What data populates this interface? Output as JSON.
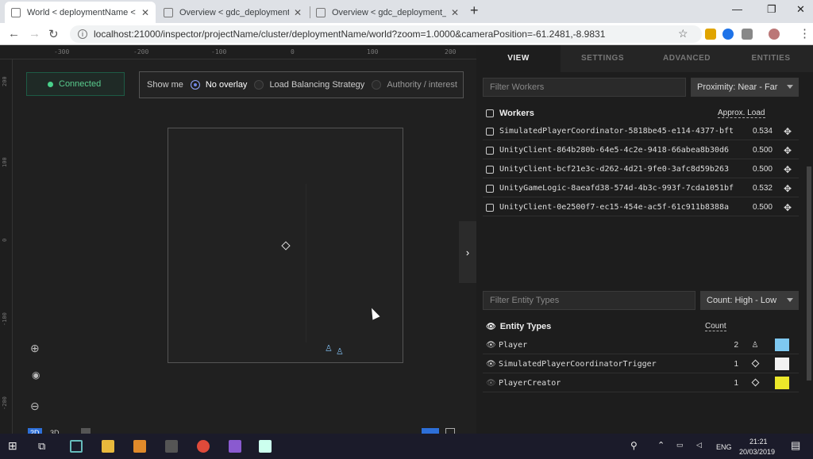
{
  "browser": {
    "tabs": [
      {
        "title": "World < deploymentName < pr"
      },
      {
        "title": "Overview < gdc_deployment < g"
      },
      {
        "title": "Overview < gdc_deployment_sir"
      }
    ],
    "url": "localhost:21000/inspector/projectName/cluster/deploymentName/world?zoom=1.0000&cameraPosition=-61.2481,-8.9831"
  },
  "ruler": {
    "top": [
      "-300",
      "-200",
      "-100",
      "0",
      "100",
      "200"
    ],
    "left": [
      "200",
      "100",
      "0",
      "-100",
      "-200"
    ]
  },
  "status": {
    "connected": "Connected"
  },
  "overlay": {
    "label": "Show me",
    "options": [
      "No overlay",
      "Load Balancing Strategy",
      "Authority / interest"
    ],
    "selected": "No overlay"
  },
  "viewmode": {
    "a": "2D",
    "b": "3D"
  },
  "panel": {
    "tabs": [
      "VIEW",
      "SETTINGS",
      "ADVANCED",
      "ENTITIES"
    ],
    "workers": {
      "filter_placeholder": "Filter Workers",
      "sort": "Proximity: Near - Far",
      "header": "Workers",
      "load_header": "Approx. Load",
      "rows": [
        {
          "name": "SimulatedPlayerCoordinator-5818be45-e114-4377-bft",
          "load": "0.534"
        },
        {
          "name": "UnityClient-864b280b-64e5-4c2e-9418-66abea8b30d6",
          "load": "0.500"
        },
        {
          "name": "UnityClient-bcf21e3c-d262-4d21-9fe0-3afc8d59b263",
          "load": "0.500"
        },
        {
          "name": "UnityGameLogic-8aeafd38-574d-4b3c-993f-7cda1051bf",
          "load": "0.532"
        },
        {
          "name": "UnityClient-0e2500f7-ec15-454e-ac5f-61c911b8388a",
          "load": "0.500"
        }
      ]
    },
    "entities": {
      "filter_placeholder": "Filter Entity Types",
      "sort": "Count: High - Low",
      "header": "Entity Types",
      "count_header": "Count",
      "rows": [
        {
          "name": "Player",
          "count": "2",
          "icon": "person-icon",
          "color": "#7ec8f0",
          "visible": true
        },
        {
          "name": "SimulatedPlayerCoordinatorTrigger",
          "count": "1",
          "icon": "diamond-icon",
          "color": "#f2f2f2",
          "visible": true
        },
        {
          "name": "PlayerCreator",
          "count": "1",
          "icon": "diamond-icon",
          "color": "#ece82a",
          "visible": false
        }
      ]
    }
  },
  "taskbar": {
    "lang": "ENG",
    "time": "21:21",
    "date": "20/03/2019"
  }
}
